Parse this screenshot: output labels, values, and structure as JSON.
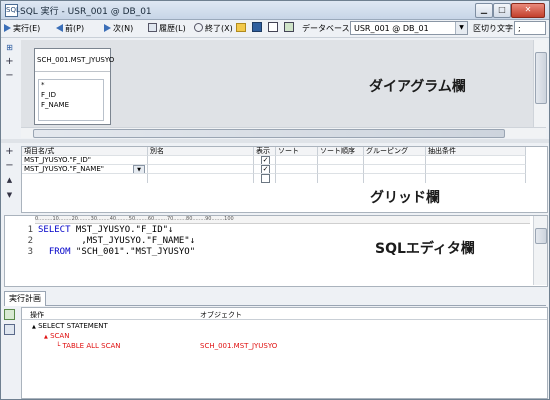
{
  "window": {
    "title": "SQL 実行 - USR_001 @ DB_01",
    "app_icon": "SQL"
  },
  "toolbar": {
    "run_label": "実行(E)",
    "prev_label": "前(P)",
    "next_label": "次(N)",
    "history_label": "履歴(L)",
    "exit_label": "終了(X)",
    "database_label": "データベース",
    "database_value": "USR_001 @ DB_01",
    "delimiter_label": "区切り文字",
    "delimiter_value": ";"
  },
  "diagram": {
    "table_name": "SCH_001.MST_JYUSYO",
    "fields": [
      "*",
      "F_ID",
      "F_NAME"
    ],
    "section_label": "ダイアグラム欄"
  },
  "grid": {
    "headers": [
      "項目名/式",
      "別名",
      "表示",
      "ソート",
      "ソート順序",
      "グルーピング",
      "抽出条件"
    ],
    "rows": [
      {
        "expr": "MST_JYUSYO.\"F_ID\"",
        "show": true
      },
      {
        "expr": "MST_JYUSYO.\"F_NAME\"",
        "show": true
      },
      {
        "expr": "",
        "show": false
      }
    ],
    "section_label": "グリッド欄"
  },
  "editor": {
    "ruler_text": "0.........10........20........30........40........50........60........70........80........90........100",
    "lines": [
      {
        "num": "1",
        "kw": "SELECT",
        "rest": " MST_JYUSYO.\"F_ID\"↓"
      },
      {
        "num": "2",
        "kw": "",
        "rest": "        ,MST_JYUSYO.\"F_NAME\"↓"
      },
      {
        "num": "3",
        "kw": "  FROM",
        "rest": " \"SCH_001\".\"MST_JYUSYO\""
      }
    ],
    "section_label": "SQLエディタ欄"
  },
  "plan": {
    "tab_label": "実行計画",
    "col_operation": "操作",
    "col_object": "オブジェクト",
    "rows": [
      {
        "op": "SELECT STATEMENT",
        "obj": ""
      },
      {
        "op": "SCAN",
        "obj": ""
      },
      {
        "op": "TABLE ALL SCAN",
        "obj": "SCH_001.MST_JYUSYO"
      }
    ]
  },
  "colors": {
    "keyword": "#0000c8",
    "plan_highlight": "#e01010"
  }
}
